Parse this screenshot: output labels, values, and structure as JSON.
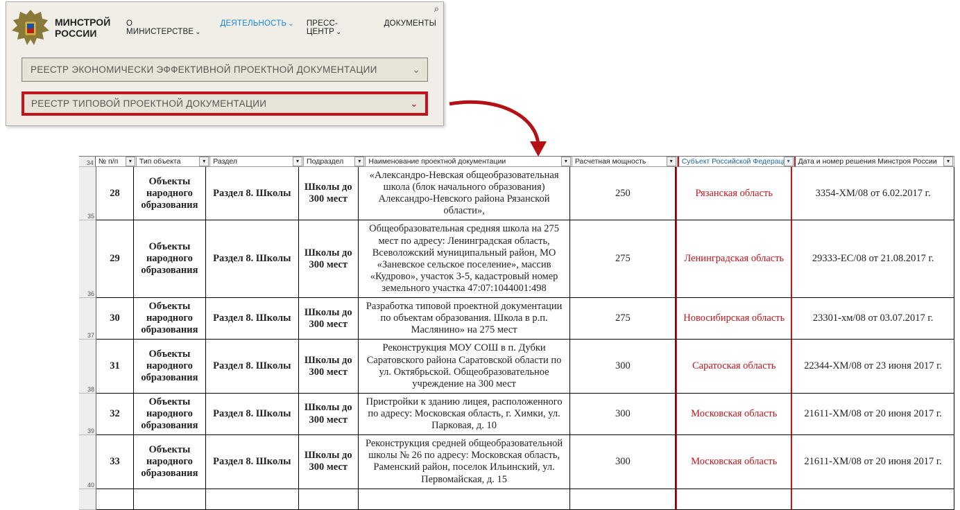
{
  "site": {
    "title_line1": "МИНСТРОЙ",
    "title_line2": "РОССИИ"
  },
  "nav": {
    "about": "О МИНИСТЕРСТВЕ",
    "activity": "ДЕЯТЕЛЬНОСТЬ",
    "press": "ПРЕСС-ЦЕНТР",
    "docs": "ДОКУМЕНТЫ"
  },
  "dropdowns": {
    "d1": "РЕЕСТР ЭКОНОМИЧЕСКИ ЭФФЕКТИВНОЙ ПРОЕКТНОЙ ДОКУМЕНТАЦИИ",
    "d2": "РЕЕСТР ТИПОВОЙ ПРОЕКТНОЙ ДОКУМЕНТАЦИИ"
  },
  "sheet": {
    "gutter_top": "34",
    "columns": {
      "num": "№ п/п",
      "type": "Тип объекта",
      "section": "Раздел",
      "subsection": "Подраздел",
      "name": "Наименование проектной документации",
      "capacity": "Расчетная мощность",
      "subject": "Субъект Российской Федерации",
      "decision": "Дата и номер решения Минстроя России"
    },
    "rows": [
      {
        "gutter": "35",
        "num": "28",
        "type": "Объекты народного образования",
        "section": "Раздел 8. Школы",
        "subsection": "Школы до 300 мест",
        "name": "«Александро-Невская общеобразовательная школа (блок начального образования) Александро-Невского района Рязанской области»,",
        "capacity": "250",
        "subject": "Рязанская область",
        "decision": "3354-ХМ/08 от 6.02.2017 г."
      },
      {
        "gutter": "36",
        "num": "29",
        "type": "Объекты народного образования",
        "section": "Раздел 8. Школы",
        "subsection": "Школы до 300 мест",
        "name": "Общеобразовательная средняя школа на 275 мест по адресу: Ленинградская область, Всеволожский муниципальный район, МО «Заневское сельское поселение», массив «Кудрово», участок 3-5, кадастровый номер земельного участка 47:07:1044001:498",
        "capacity": "275",
        "subject": "Ленинградская область",
        "decision": "29333-ЕС/08 от 21.08.2017 г."
      },
      {
        "gutter": "37",
        "num": "30",
        "type": "Объекты народного образования",
        "section": "Раздел 8. Школы",
        "subsection": "Школы до 300 мест",
        "name": "Разработка типовой проектной документации по объектам образования. Школа в р.п. Маслянино» на 275 мест",
        "capacity": "275",
        "subject": "Новосибирская область",
        "decision": "23301-хм/08 от 03.07.2017 г."
      },
      {
        "gutter": "38",
        "num": "31",
        "type": "Объекты народного образования",
        "section": "Раздел 8. Школы",
        "subsection": "Школы до 300 мест",
        "name": "Реконструкция МОУ СОШ в п. Дубки Саратовского района Саратовской области по ул. Октябрьской. Общеобразовательное учреждение на 300 мест",
        "capacity": "300",
        "subject": "Саратоская область",
        "decision": "22344-ХМ/08 от 23 июня 2017 г."
      },
      {
        "gutter": "39",
        "num": "32",
        "type": "Объекты народного образования",
        "section": "Раздел 8. Школы",
        "subsection": "Школы до 300 мест",
        "name": "Пристройки к зданию лицея, расположенного по адресу: Московская область, г. Химки, ул. Парковая, д. 10",
        "capacity": "300",
        "subject": "Московская область",
        "decision": "21611-ХМ/08 от 20 июня 2017 г."
      },
      {
        "gutter": "40",
        "num": "33",
        "type": "Объекты народного образования",
        "section": "Раздел 8. Школы",
        "subsection": "Школы до 300 мест",
        "name": "Реконструкция средней общеобразовательной школы № 26 по адресу: Московская область, Раменский район, поселок Ильинский, ул. Первомайская, д. 15",
        "capacity": "300",
        "subject": "Московская область",
        "decision": "21611-ХМ/08 от 20 июня 2017 г."
      }
    ]
  }
}
